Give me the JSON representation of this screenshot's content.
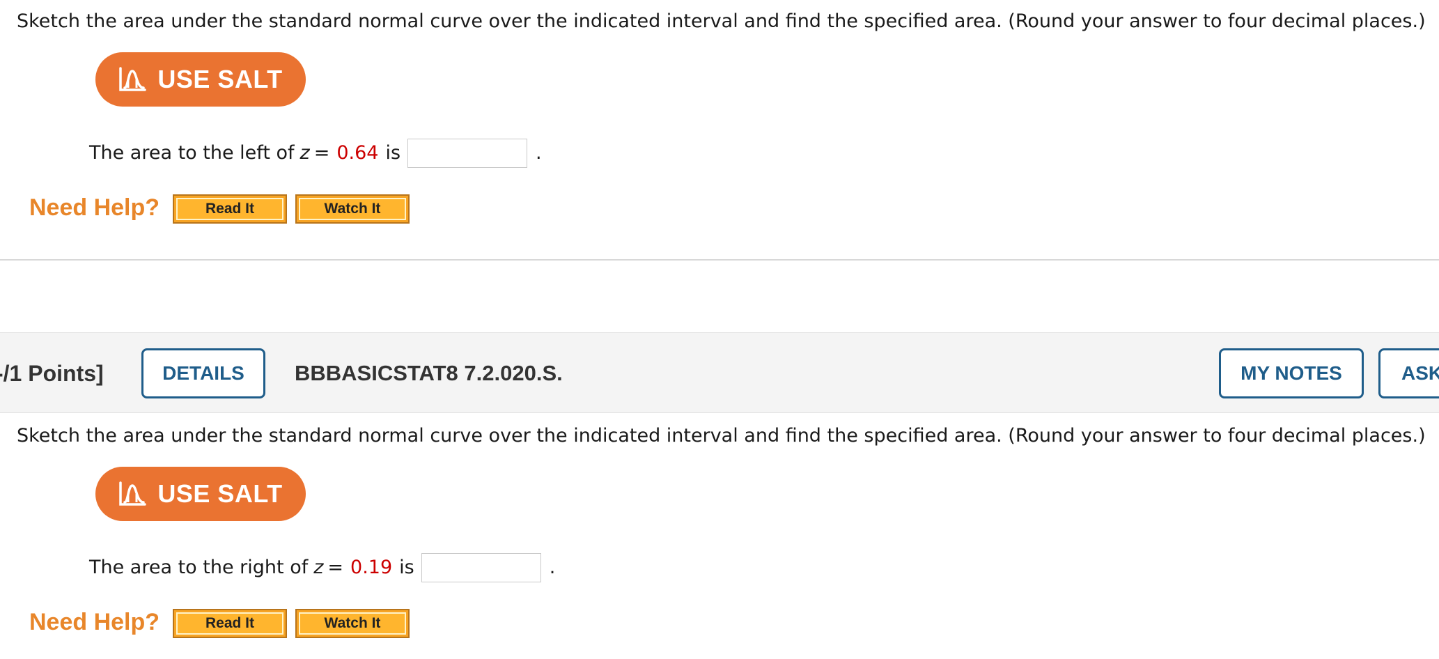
{
  "question1": {
    "instructions": "Sketch the area under the standard normal curve over the indicated interval and find the specified area. (Round your answer to four decimal places.)",
    "salt_button_label": "USE SALT",
    "salt_icon": "salt-graph-icon",
    "prefix": "The area to the left of",
    "variable": "z",
    "equals": "=",
    "value": "0.64",
    "suffix": "is",
    "answer_value": "",
    "period": ".",
    "need_help_label": "Need Help?",
    "read_it_label": "Read It",
    "watch_it_label": "Watch It"
  },
  "question2_header": {
    "points_label": "-/1 Points]",
    "details_label": "DETAILS",
    "question_id": "BBBASICSTAT8 7.2.020.S.",
    "my_notes_label": "MY NOTES",
    "ask_label": "ASK"
  },
  "question2": {
    "instructions": "Sketch the area under the standard normal curve over the indicated interval and find the specified area. (Round your answer to four decimal places.)",
    "salt_button_label": "USE SALT",
    "salt_icon": "salt-graph-icon",
    "prefix": "The area to the right of",
    "variable": "z",
    "equals": "=",
    "value": "0.19",
    "suffix": "is",
    "answer_value": "",
    "period": ".",
    "need_help_label": "Need Help?",
    "read_it_label": "Read It",
    "watch_it_label": "Watch It"
  },
  "colors": {
    "salt_orange": "#ea7331",
    "value_red": "#cc0000",
    "need_help_orange": "#e8862a",
    "help_button_yellow": "#ffb52e",
    "header_blue": "#1f5d8a",
    "header_bg": "#f4f4f4"
  }
}
